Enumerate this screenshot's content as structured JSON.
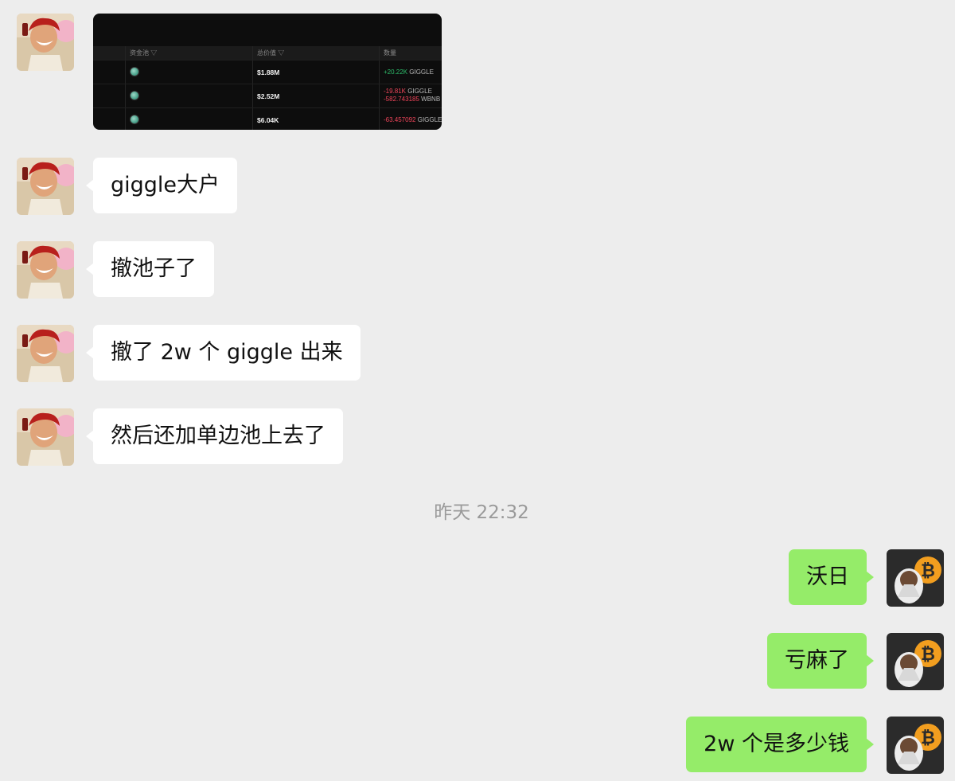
{
  "chat": {
    "incoming": [
      {
        "text": "giggle大户"
      },
      {
        "text": "撤池子了"
      },
      {
        "text": "撤了 2w 个 giggle 出来"
      },
      {
        "text": "然后还加单边池上去了"
      }
    ],
    "timestamp": "昨天 22:32",
    "outgoing": [
      {
        "text": "沃日"
      },
      {
        "text": "亏麻了"
      },
      {
        "text": "2w 个是多少钱"
      }
    ]
  },
  "screenshot": {
    "headers": {
      "pool": "资金池 ▽",
      "total_value": "总价值 ▽",
      "quantity": "数量"
    },
    "rows": [
      {
        "value": "$1.88M",
        "amounts": [
          {
            "num": "+20.22K",
            "token": "GIGGLE"
          }
        ]
      },
      {
        "value": "$2.52M",
        "amounts": [
          {
            "num": "-19.81K",
            "token": "GIGGLE"
          },
          {
            "num": "-582.743185",
            "token": "WBNB"
          }
        ]
      },
      {
        "value": "$6.04K",
        "amounts": [
          {
            "num": "-63.457092",
            "token": "GIGGLE"
          }
        ]
      }
    ]
  },
  "colors": {
    "background": "#ededed",
    "incoming_bubble": "#ffffff",
    "outgoing_bubble": "#95ec69",
    "positive": "#2ebd6b",
    "negative": "#f0455a"
  },
  "icons": {
    "contact_avatar": "red-haired-laughing-character-avatar",
    "self_avatar": "astronaut-bitcoin-avatar"
  }
}
